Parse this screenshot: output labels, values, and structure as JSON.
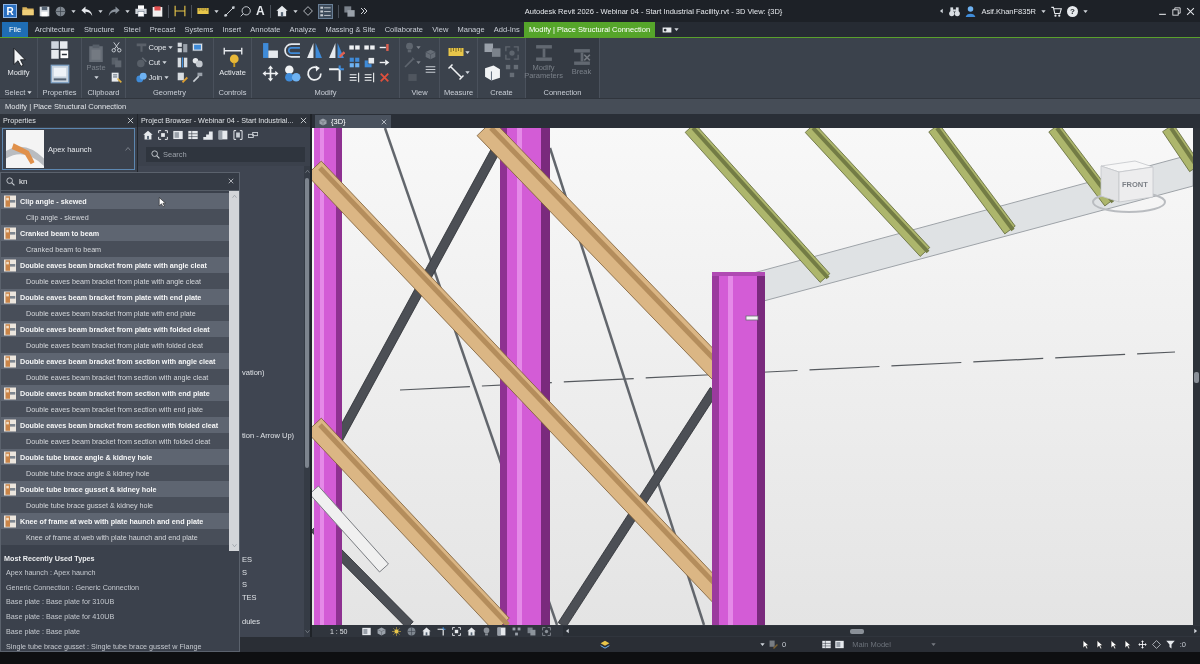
{
  "title_bar": {
    "app_logo": "R",
    "text_tool": "A",
    "title": "Autodesk Revit 2026 - Webinar 04 - Start Industrial Facility.rvt - 3D View: {3D}",
    "user": "Asif.KhanF835R",
    "help": "?"
  },
  "ribbon_tabs": [
    {
      "label": "File",
      "kind": "file",
      "selected": false
    },
    {
      "label": "Architecture",
      "kind": "tab",
      "selected": false
    },
    {
      "label": "Structure",
      "kind": "tab",
      "selected": false
    },
    {
      "label": "Steel",
      "kind": "tab",
      "selected": false
    },
    {
      "label": "Precast",
      "kind": "tab",
      "selected": false
    },
    {
      "label": "Systems",
      "kind": "tab",
      "selected": false
    },
    {
      "label": "Insert",
      "kind": "tab",
      "selected": false
    },
    {
      "label": "Annotate",
      "kind": "tab",
      "selected": false
    },
    {
      "label": "Analyze",
      "kind": "tab",
      "selected": false
    },
    {
      "label": "Massing & Site",
      "kind": "tab",
      "selected": false
    },
    {
      "label": "Collaborate",
      "kind": "tab",
      "selected": false
    },
    {
      "label": "View",
      "kind": "tab",
      "selected": false
    },
    {
      "label": "Manage",
      "kind": "tab",
      "selected": false
    },
    {
      "label": "Add-Ins",
      "kind": "tab",
      "selected": false
    },
    {
      "label": "Modify | Place Structural Connection",
      "kind": "context",
      "selected": true
    }
  ],
  "ribbon_panels": [
    {
      "kind": "select",
      "label": "Select",
      "dropdown": true,
      "buttons": [
        {
          "label": "Modify",
          "disabled": false
        }
      ]
    },
    {
      "kind": "properties",
      "label": "Properties"
    },
    {
      "kind": "clipboard",
      "label": "Clipboard",
      "buttons": [
        {
          "label": "Paste",
          "disabled": true,
          "dropdown": true
        }
      ]
    },
    {
      "kind": "geometry",
      "label": "Geometry",
      "buttons": [
        {
          "label": "Cope",
          "disabled": true,
          "dropdown": true
        },
        {
          "label": "Cut",
          "disabled": true,
          "dropdown": true
        },
        {
          "label": "Join",
          "disabled": false,
          "dropdown": true
        }
      ]
    },
    {
      "kind": "controls",
      "label": "Controls",
      "buttons": [
        {
          "label": "Activate",
          "disabled": false
        }
      ]
    },
    {
      "kind": "modify",
      "label": "Modify"
    },
    {
      "kind": "view",
      "label": "View"
    },
    {
      "kind": "measure",
      "label": "Measure"
    },
    {
      "kind": "create",
      "label": "Create"
    },
    {
      "kind": "connection",
      "label": "Connection",
      "buttons": [
        {
          "label": "Modify Parameters",
          "disabled": true
        },
        {
          "label": "Break",
          "disabled": true
        }
      ]
    }
  ],
  "options_bar": {
    "text": "Modify | Place Structural Connection"
  },
  "properties": {
    "title": "Properties",
    "type_name": "Apex haunch"
  },
  "type_dropdown": {
    "search": {
      "value": "kn"
    },
    "groups": [
      {
        "name": "Clip angle - skewed",
        "children": [
          {
            "name": "Clip angle - skewed"
          }
        ]
      },
      {
        "name": "Cranked beam to beam",
        "children": [
          {
            "name": "Cranked beam to beam"
          }
        ]
      },
      {
        "name": "Double eaves beam bracket from plate with angle cleat",
        "children": [
          {
            "name": "Double eaves beam bracket from plate with angle cleat"
          }
        ]
      },
      {
        "name": "Double eaves beam bracket from plate with end plate",
        "children": [
          {
            "name": "Double eaves beam bracket from plate with end plate"
          }
        ]
      },
      {
        "name": "Double eaves beam bracket from plate with folded cleat",
        "children": [
          {
            "name": "Double eaves beam bracket from plate with folded cleat"
          }
        ]
      },
      {
        "name": "Double eaves beam bracket from section with angle cleat",
        "children": [
          {
            "name": "Double eaves beam bracket from section with angle cleat"
          }
        ]
      },
      {
        "name": "Double eaves beam bracket from section with end plate",
        "children": [
          {
            "name": "Double eaves beam bracket from section with end plate"
          }
        ]
      },
      {
        "name": "Double eaves beam bracket from section with folded cleat",
        "children": [
          {
            "name": "Double eaves beam bracket from section with folded cleat"
          }
        ]
      },
      {
        "name": "Double tube brace angle & kidney hole",
        "children": [
          {
            "name": "Double tube brace angle & kidney hole"
          }
        ]
      },
      {
        "name": "Double tube brace gusset & kidney hole",
        "children": [
          {
            "name": "Double tube brace gusset & kidney hole"
          }
        ]
      },
      {
        "name": "Knee of frame at web with plate haunch and end plate",
        "children": [
          {
            "name": "Knee of frame at web with plate haunch and end plate"
          }
        ]
      }
    ],
    "recent_title": "Most Recently Used Types",
    "recent": [
      "Apex haunch : Apex haunch",
      "Generic Connection : Generic Connection",
      "Base plate : Base plate for 310UB",
      "Base plate : Base plate for 410UB",
      "Base plate : Base plate",
      "Single tube brace gusset : Single tube brace gusset w Flange"
    ]
  },
  "project_browser": {
    "title": "Project Browser - Webinar 04 - Start Industrial...",
    "search": {
      "placeholder": "Search"
    },
    "rows": [
      "vation)",
      "tion - Arrow Up)",
      "ES",
      "S",
      "S",
      "TES",
      "dules"
    ]
  },
  "view": {
    "tab": {
      "label": "{3D}",
      "selected": true
    },
    "view_cube_face": "FRONT",
    "scale": "1 : 50"
  },
  "status_bar": {
    "counter": "0",
    "model": {
      "label": "Main Model",
      "disabled": true
    },
    "filter_count": ":0"
  }
}
